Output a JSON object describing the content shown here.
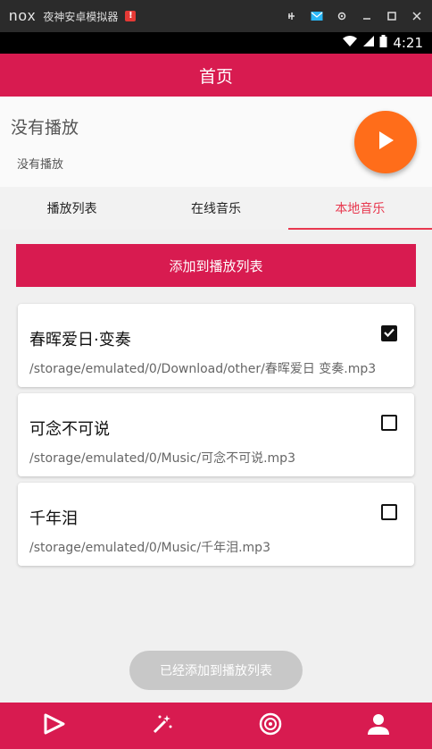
{
  "emulator": {
    "logo": "nox",
    "title": "夜神安卓模拟器",
    "badge": "!",
    "controls": [
      "pin-icon",
      "mail-icon",
      "gear-icon",
      "minimize-icon",
      "maximize-icon",
      "close-icon"
    ]
  },
  "status": {
    "time": "4:21"
  },
  "appbar": {
    "title": "首页"
  },
  "player": {
    "title": "没有播放",
    "subtitle": "没有播放"
  },
  "tabs": [
    {
      "label": "播放列表",
      "active": false
    },
    {
      "label": "在线音乐",
      "active": false
    },
    {
      "label": "本地音乐",
      "active": true
    }
  ],
  "add_button": {
    "label": "添加到播放列表"
  },
  "songs": [
    {
      "title": "春晖爱日·变奏",
      "path": "/storage/emulated/0/Download/other/春晖爱日 变奏.mp3",
      "checked": true
    },
    {
      "title": "可念不可说",
      "path": "/storage/emulated/0/Music/可念不可说.mp3",
      "checked": false
    },
    {
      "title": "千年泪",
      "path": "/storage/emulated/0/Music/千年泪.mp3",
      "checked": false
    }
  ],
  "toast": {
    "text": "已经添加到播放列表"
  },
  "bottom_nav": [
    "play-icon",
    "magic-wand-icon",
    "disc-icon",
    "person-icon"
  ],
  "colors": {
    "primary": "#d81b50",
    "accent": "#ff6d1a",
    "tab_active": "#e8384f"
  }
}
